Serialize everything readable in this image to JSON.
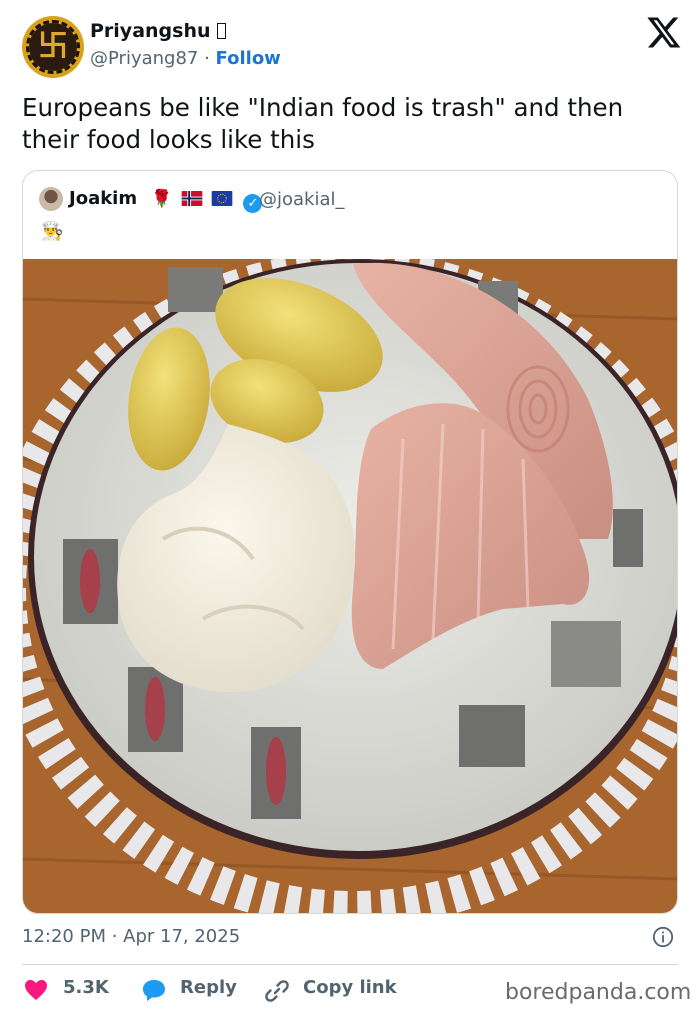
{
  "author": {
    "name": "Priyangshu",
    "handle": "@Priyang87",
    "separator": " · ",
    "follow_label": "Follow",
    "avatar_glyph": "卐"
  },
  "tweet": {
    "text": "Europeans be like \"Indian food is trash\" and then their food looks like this",
    "time": "12:20 PM · Apr 17, 2025"
  },
  "quoted": {
    "name": "Joakim",
    "emoji_rose": "🌹",
    "handle": "@joakial_",
    "second_line_emoji": "👨‍🍳"
  },
  "actions": {
    "like_count": "5.3K",
    "reply_label": "Reply",
    "copy_label": "Copy link"
  },
  "watermark": "boredpanda.com",
  "colors": {
    "like": "#f91880",
    "reply": "#1d9bf0",
    "follow": "#1d74d1",
    "verified": "#1d9bf0"
  },
  "icons": [
    "x-logo-icon",
    "info-icon",
    "heart-icon",
    "reply-bubble-icon",
    "link-icon",
    "verified-badge-icon"
  ]
}
